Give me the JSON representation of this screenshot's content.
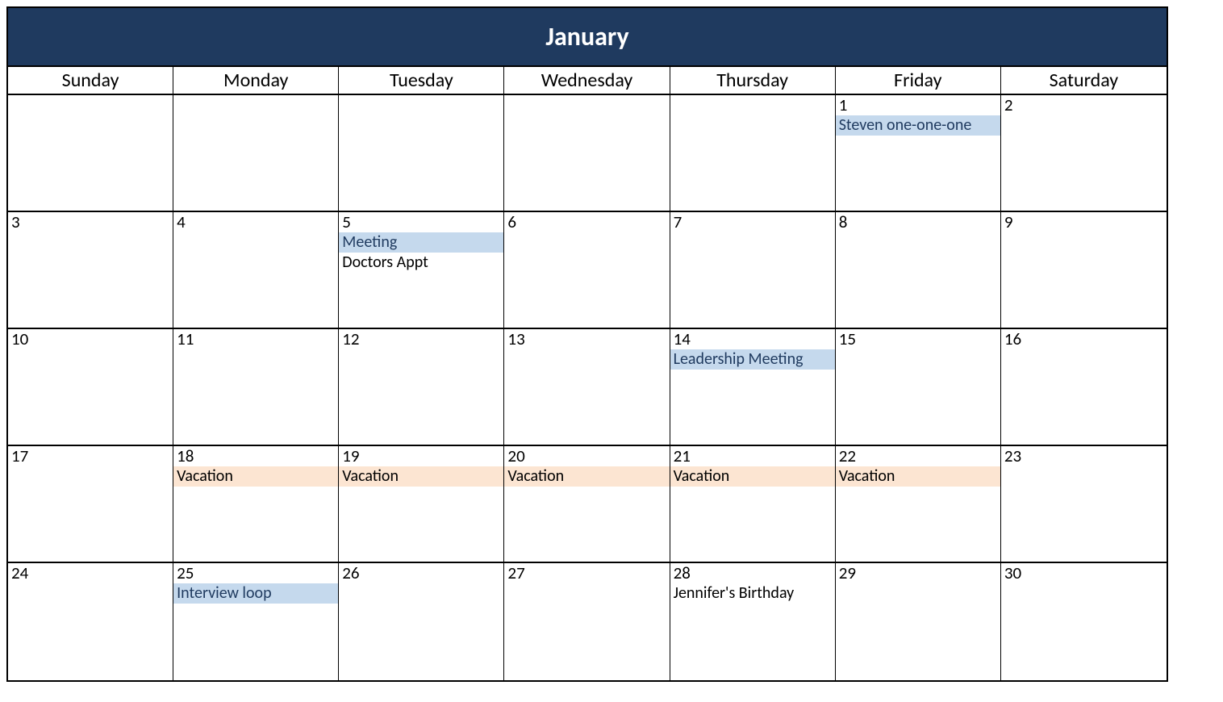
{
  "month": "January",
  "dayNames": [
    "Sunday",
    "Monday",
    "Tuesday",
    "Wednesday",
    "Thursday",
    "Friday",
    "Saturday"
  ],
  "weeks": [
    [
      {
        "date": "",
        "events": []
      },
      {
        "date": "",
        "events": []
      },
      {
        "date": "",
        "events": []
      },
      {
        "date": "",
        "events": []
      },
      {
        "date": "",
        "events": []
      },
      {
        "date": "1",
        "events": [
          {
            "label": "Steven one-one-one",
            "style": "blue"
          }
        ]
      },
      {
        "date": "2",
        "events": []
      }
    ],
    [
      {
        "date": "3",
        "events": []
      },
      {
        "date": "4",
        "events": []
      },
      {
        "date": "5",
        "events": [
          {
            "label": "Meeting",
            "style": "blue"
          },
          {
            "label": "Doctors Appt",
            "style": "plain"
          }
        ]
      },
      {
        "date": "6",
        "events": []
      },
      {
        "date": "7",
        "events": []
      },
      {
        "date": "8",
        "events": []
      },
      {
        "date": "9",
        "events": []
      }
    ],
    [
      {
        "date": "10",
        "events": []
      },
      {
        "date": "11",
        "events": []
      },
      {
        "date": "12",
        "events": []
      },
      {
        "date": "13",
        "events": []
      },
      {
        "date": "14",
        "events": [
          {
            "label": "Leadership Meeting",
            "style": "blue"
          }
        ]
      },
      {
        "date": "15",
        "events": []
      },
      {
        "date": "16",
        "events": []
      }
    ],
    [
      {
        "date": "17",
        "events": []
      },
      {
        "date": "18",
        "events": [
          {
            "label": "Vacation",
            "style": "peach"
          }
        ]
      },
      {
        "date": "19",
        "events": [
          {
            "label": "Vacation",
            "style": "peach"
          }
        ]
      },
      {
        "date": "20",
        "events": [
          {
            "label": "Vacation",
            "style": "peach"
          }
        ]
      },
      {
        "date": "21",
        "events": [
          {
            "label": "Vacation",
            "style": "peach"
          }
        ]
      },
      {
        "date": "22",
        "events": [
          {
            "label": "Vacation",
            "style": "peach"
          }
        ]
      },
      {
        "date": "23",
        "events": []
      }
    ],
    [
      {
        "date": "24",
        "events": []
      },
      {
        "date": "25",
        "events": [
          {
            "label": "Interview loop",
            "style": "blue"
          }
        ]
      },
      {
        "date": "26",
        "events": []
      },
      {
        "date": "27",
        "events": []
      },
      {
        "date": "28",
        "events": [
          {
            "label": "Jennifer's Birthday",
            "style": "plain"
          }
        ]
      },
      {
        "date": "29",
        "events": []
      },
      {
        "date": "30",
        "events": []
      }
    ]
  ]
}
